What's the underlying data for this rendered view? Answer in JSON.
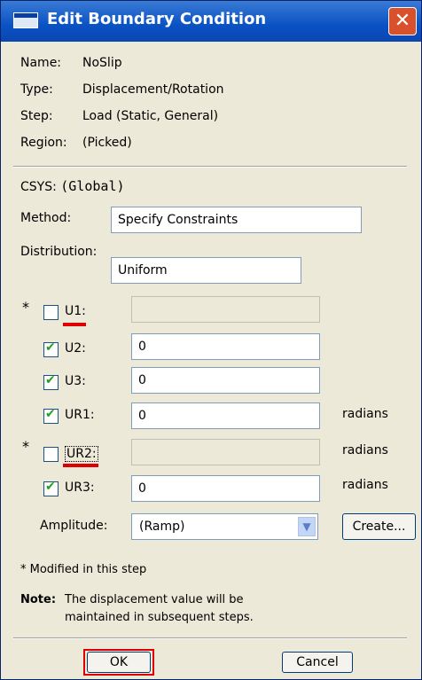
{
  "window": {
    "title": "Edit Boundary Condition",
    "close_glyph": "✕"
  },
  "info": {
    "name_label": "Name:",
    "name_value": "NoSlip",
    "type_label": "Type:",
    "type_value": "Displacement/Rotation",
    "step_label": "Step:",
    "step_value": "Load (Static, General)",
    "region_label": "Region:",
    "region_value": "(Picked)"
  },
  "csys": {
    "label": "CSYS:",
    "value": "(Global)"
  },
  "method": {
    "label": "Method:",
    "value": "Specify Constraints"
  },
  "distribution": {
    "label": "Distribution:",
    "value": "Uniform"
  },
  "dofs": [
    {
      "label": "U1:",
      "checked": false,
      "value": "",
      "units": "",
      "modified": true
    },
    {
      "label": "U2:",
      "checked": true,
      "value": "0",
      "units": "",
      "modified": false
    },
    {
      "label": "U3:",
      "checked": true,
      "value": "0",
      "units": "",
      "modified": false
    },
    {
      "label": "UR1:",
      "checked": true,
      "value": "0",
      "units": "radians",
      "modified": false
    },
    {
      "label": "UR2:",
      "checked": false,
      "value": "",
      "units": "radians",
      "modified": true
    },
    {
      "label": "UR3:",
      "checked": true,
      "value": "0",
      "units": "radians",
      "modified": false
    }
  ],
  "star": "*",
  "amplitude": {
    "label": "Amplitude:",
    "value": "(Ramp)",
    "create_label": "Create..."
  },
  "footnote": "* Modified in this step",
  "note": {
    "label": "Note:",
    "line1": "The displacement value will be",
    "line2": "maintained in subsequent steps."
  },
  "buttons": {
    "ok": "OK",
    "cancel": "Cancel"
  },
  "colors": {
    "titlebar": "#0a52c4",
    "dialog_bg": "#ece9d8",
    "highlight": "#e00000",
    "check": "#21a121"
  }
}
